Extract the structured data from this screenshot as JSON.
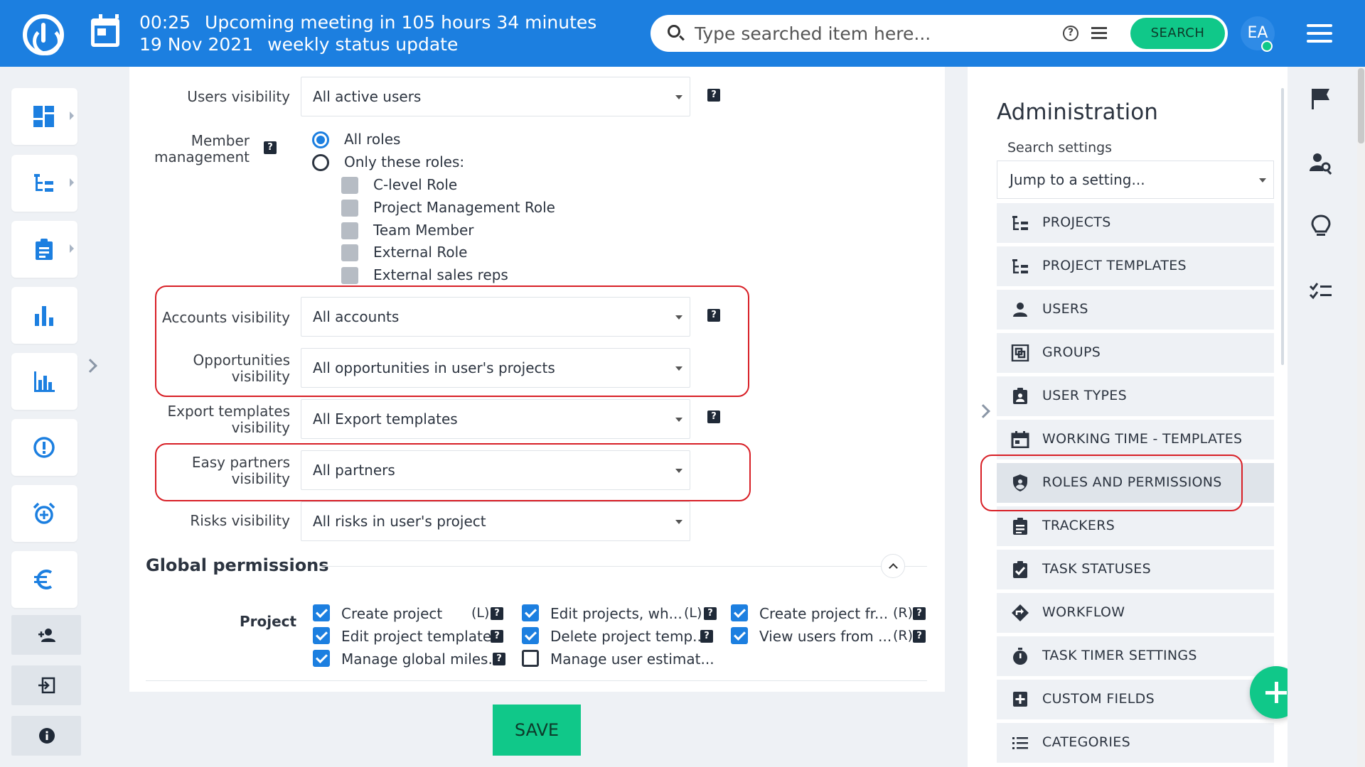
{
  "topbar": {
    "meeting_time": "00:25",
    "meeting_text": "Upcoming meeting in 105 hours 34 minutes",
    "meeting_date": "19 Nov 2021",
    "meeting_name": "weekly status update",
    "search_placeholder": "Type searched item here...",
    "search_button": "SEARCH",
    "avatar_initials": "EA"
  },
  "form": {
    "users_visibility": {
      "label": "Users visibility",
      "value": "All active users"
    },
    "member_management": {
      "label_line1": "Member",
      "label_line2": "management",
      "option_all": "All roles",
      "option_only": "Only these roles:",
      "roles": [
        "C-level Role",
        "Project Management Role",
        "Team Member",
        "External Role",
        "External sales reps"
      ]
    },
    "accounts_visibility": {
      "label": "Accounts visibility",
      "value": "All accounts"
    },
    "opportunities_visibility": {
      "label_line1": "Opportunities",
      "label_line2": "visibility",
      "value": "All opportunities in user's projects"
    },
    "export_templates_visibility": {
      "label_line1": "Export templates",
      "label_line2": "visibility",
      "value": "All Export templates"
    },
    "easy_partners_visibility": {
      "label_line1": "Easy partners",
      "label_line2": "visibility",
      "value": "All partners"
    },
    "risks_visibility": {
      "label": "Risks visibility",
      "value": "All risks in user's project"
    },
    "help_mark": "?"
  },
  "global_permissions": {
    "title": "Global permissions",
    "group_label": "Project",
    "items": [
      {
        "label": "Create project",
        "tag": "(L)",
        "checked": true
      },
      {
        "label": "Edit projects, wh...",
        "tag": "(L)",
        "checked": true
      },
      {
        "label": "Create project fr...",
        "tag": "(R)",
        "checked": true
      },
      {
        "label": "Edit project template",
        "tag": "",
        "checked": true
      },
      {
        "label": "Delete project temp...",
        "tag": "",
        "checked": true
      },
      {
        "label": "View users from ...",
        "tag": "(R)",
        "checked": true
      },
      {
        "label": "Manage global miles...",
        "tag": "",
        "checked": true
      },
      {
        "label": "Manage user estimat...",
        "tag": "",
        "checked": false
      }
    ]
  },
  "save_label": "SAVE",
  "admin": {
    "title": "Administration",
    "search_label": "Search settings",
    "jump_placeholder": "Jump to a setting...",
    "items": [
      {
        "label": "PROJECTS",
        "icon": "project-tree-icon"
      },
      {
        "label": "PROJECT TEMPLATES",
        "icon": "project-tree-icon"
      },
      {
        "label": "USERS",
        "icon": "person-icon"
      },
      {
        "label": "GROUPS",
        "icon": "group-icon"
      },
      {
        "label": "USER TYPES",
        "icon": "badge-icon"
      },
      {
        "label": "WORKING TIME - TEMPLATES",
        "icon": "calendar-icon"
      },
      {
        "label": "ROLES AND PERMISSIONS",
        "icon": "shield-icon"
      },
      {
        "label": "TRACKERS",
        "icon": "clipboard-icon"
      },
      {
        "label": "TASK STATUSES",
        "icon": "clipboard-check-icon"
      },
      {
        "label": "WORKFLOW",
        "icon": "diamond-arrow-icon"
      },
      {
        "label": "TASK TIMER SETTINGS",
        "icon": "stopwatch-icon"
      },
      {
        "label": "CUSTOM FIELDS",
        "icon": "plus-box-icon"
      },
      {
        "label": "CATEGORIES",
        "icon": "list-icon"
      }
    ]
  },
  "colors": {
    "brand_blue": "#1c7fe0",
    "accent_green": "#10c889",
    "highlight_red": "#d81f26"
  }
}
